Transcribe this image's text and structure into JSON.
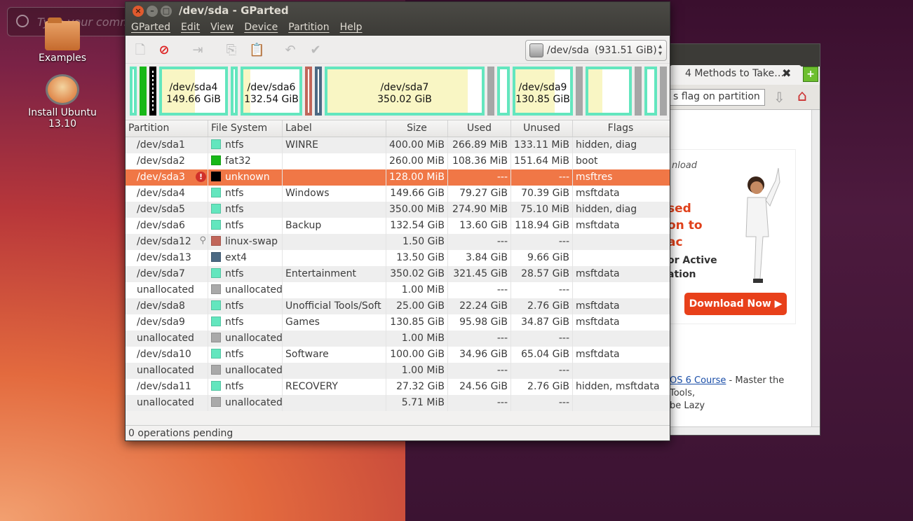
{
  "desktop": {
    "search_hint": "Type your command",
    "icons": [
      {
        "label": "Examples"
      },
      {
        "label": "Install Ubuntu 13.10"
      }
    ]
  },
  "browser": {
    "tab_title": "4 Methods to Take…",
    "search_value": "s flag on partition",
    "ad": {
      "download_text": "nload",
      "red_lines": [
        "sed",
        "on to",
        "ac"
      ],
      "black_lines": [
        "or Active",
        "ation"
      ],
      "button": "Download Now ▶"
    },
    "link_text": "OS 6 Course",
    "link_rest": " - Master the Tools,",
    "link_line2": "be Lazy"
  },
  "gparted": {
    "title": "/dev/sda - GParted",
    "menu": [
      "GParted",
      "Edit",
      "View",
      "Device",
      "Partition",
      "Help"
    ],
    "device": "/dev/sda",
    "device_size": "(931.51 GiB)",
    "map": [
      {
        "name": "/dev/sda4",
        "size": "149.66 GiB"
      },
      {
        "name": "/dev/sda6",
        "size": "132.54 GiB"
      },
      {
        "name": "/dev/sda7",
        "size": "350.02 GiB"
      },
      {
        "name": "/dev/sda9",
        "size": "130.85 GiB"
      }
    ],
    "columns": [
      "Partition",
      "File System",
      "Label",
      "Size",
      "Used",
      "Unused",
      "Flags"
    ],
    "rows": [
      {
        "partition": "/dev/sda1",
        "fs": "ntfs",
        "label": "WINRE",
        "size": "400.00 MiB",
        "used": "266.89 MiB",
        "unused": "133.11 MiB",
        "flags": "hidden, diag"
      },
      {
        "partition": "/dev/sda2",
        "fs": "fat32",
        "label": "",
        "size": "260.00 MiB",
        "used": "108.36 MiB",
        "unused": "151.64 MiB",
        "flags": "boot"
      },
      {
        "partition": "/dev/sda3",
        "fs": "unknown",
        "label": "",
        "size": "128.00 MiB",
        "used": "---",
        "unused": "---",
        "flags": "msftres"
      },
      {
        "partition": "/dev/sda4",
        "fs": "ntfs",
        "label": "Windows",
        "size": "149.66 GiB",
        "used": "79.27 GiB",
        "unused": "70.39 GiB",
        "flags": "msftdata"
      },
      {
        "partition": "/dev/sda5",
        "fs": "ntfs",
        "label": "",
        "size": "350.00 MiB",
        "used": "274.90 MiB",
        "unused": "75.10 MiB",
        "flags": "hidden, diag"
      },
      {
        "partition": "/dev/sda6",
        "fs": "ntfs",
        "label": "Backup",
        "size": "132.54 GiB",
        "used": "13.60 GiB",
        "unused": "118.94 GiB",
        "flags": "msftdata"
      },
      {
        "partition": "/dev/sda12",
        "fs": "linux-swap",
        "label": "",
        "size": "1.50 GiB",
        "used": "---",
        "unused": "---",
        "flags": ""
      },
      {
        "partition": "/dev/sda13",
        "fs": "ext4",
        "label": "",
        "size": "13.50 GiB",
        "used": "3.84 GiB",
        "unused": "9.66 GiB",
        "flags": ""
      },
      {
        "partition": "/dev/sda7",
        "fs": "ntfs",
        "label": "Entertainment",
        "size": "350.02 GiB",
        "used": "321.45 GiB",
        "unused": "28.57 GiB",
        "flags": "msftdata"
      },
      {
        "partition": "unallocated",
        "fs": "unallocated",
        "label": "",
        "size": "1.00 MiB",
        "used": "---",
        "unused": "---",
        "flags": ""
      },
      {
        "partition": "/dev/sda8",
        "fs": "ntfs",
        "label": "Unofficial Tools/Soft",
        "size": "25.00 GiB",
        "used": "22.24 GiB",
        "unused": "2.76 GiB",
        "flags": "msftdata"
      },
      {
        "partition": "/dev/sda9",
        "fs": "ntfs",
        "label": "Games",
        "size": "130.85 GiB",
        "used": "95.98 GiB",
        "unused": "34.87 GiB",
        "flags": "msftdata"
      },
      {
        "partition": "unallocated",
        "fs": "unallocated",
        "label": "",
        "size": "1.00 MiB",
        "used": "---",
        "unused": "---",
        "flags": ""
      },
      {
        "partition": "/dev/sda10",
        "fs": "ntfs",
        "label": "Software",
        "size": "100.00 GiB",
        "used": "34.96 GiB",
        "unused": "65.04 GiB",
        "flags": "msftdata"
      },
      {
        "partition": "unallocated",
        "fs": "unallocated",
        "label": "",
        "size": "1.00 MiB",
        "used": "---",
        "unused": "---",
        "flags": ""
      },
      {
        "partition": "/dev/sda11",
        "fs": "ntfs",
        "label": "RECOVERY",
        "size": "27.32 GiB",
        "used": "24.56 GiB",
        "unused": "2.76 GiB",
        "flags": "hidden, msftdata"
      },
      {
        "partition": "unallocated",
        "fs": "unallocated",
        "label": "",
        "size": "5.71 MiB",
        "used": "---",
        "unused": "---",
        "flags": ""
      }
    ],
    "status": "0 operations pending"
  },
  "colors": {
    "ntfs": "#63e6be",
    "fat32": "#18b818",
    "unknown": "#000000",
    "linux-swap": "#c1665a",
    "ext4": "#4b6983",
    "unallocated": "#a9a9a9",
    "selected": "#f07746"
  }
}
